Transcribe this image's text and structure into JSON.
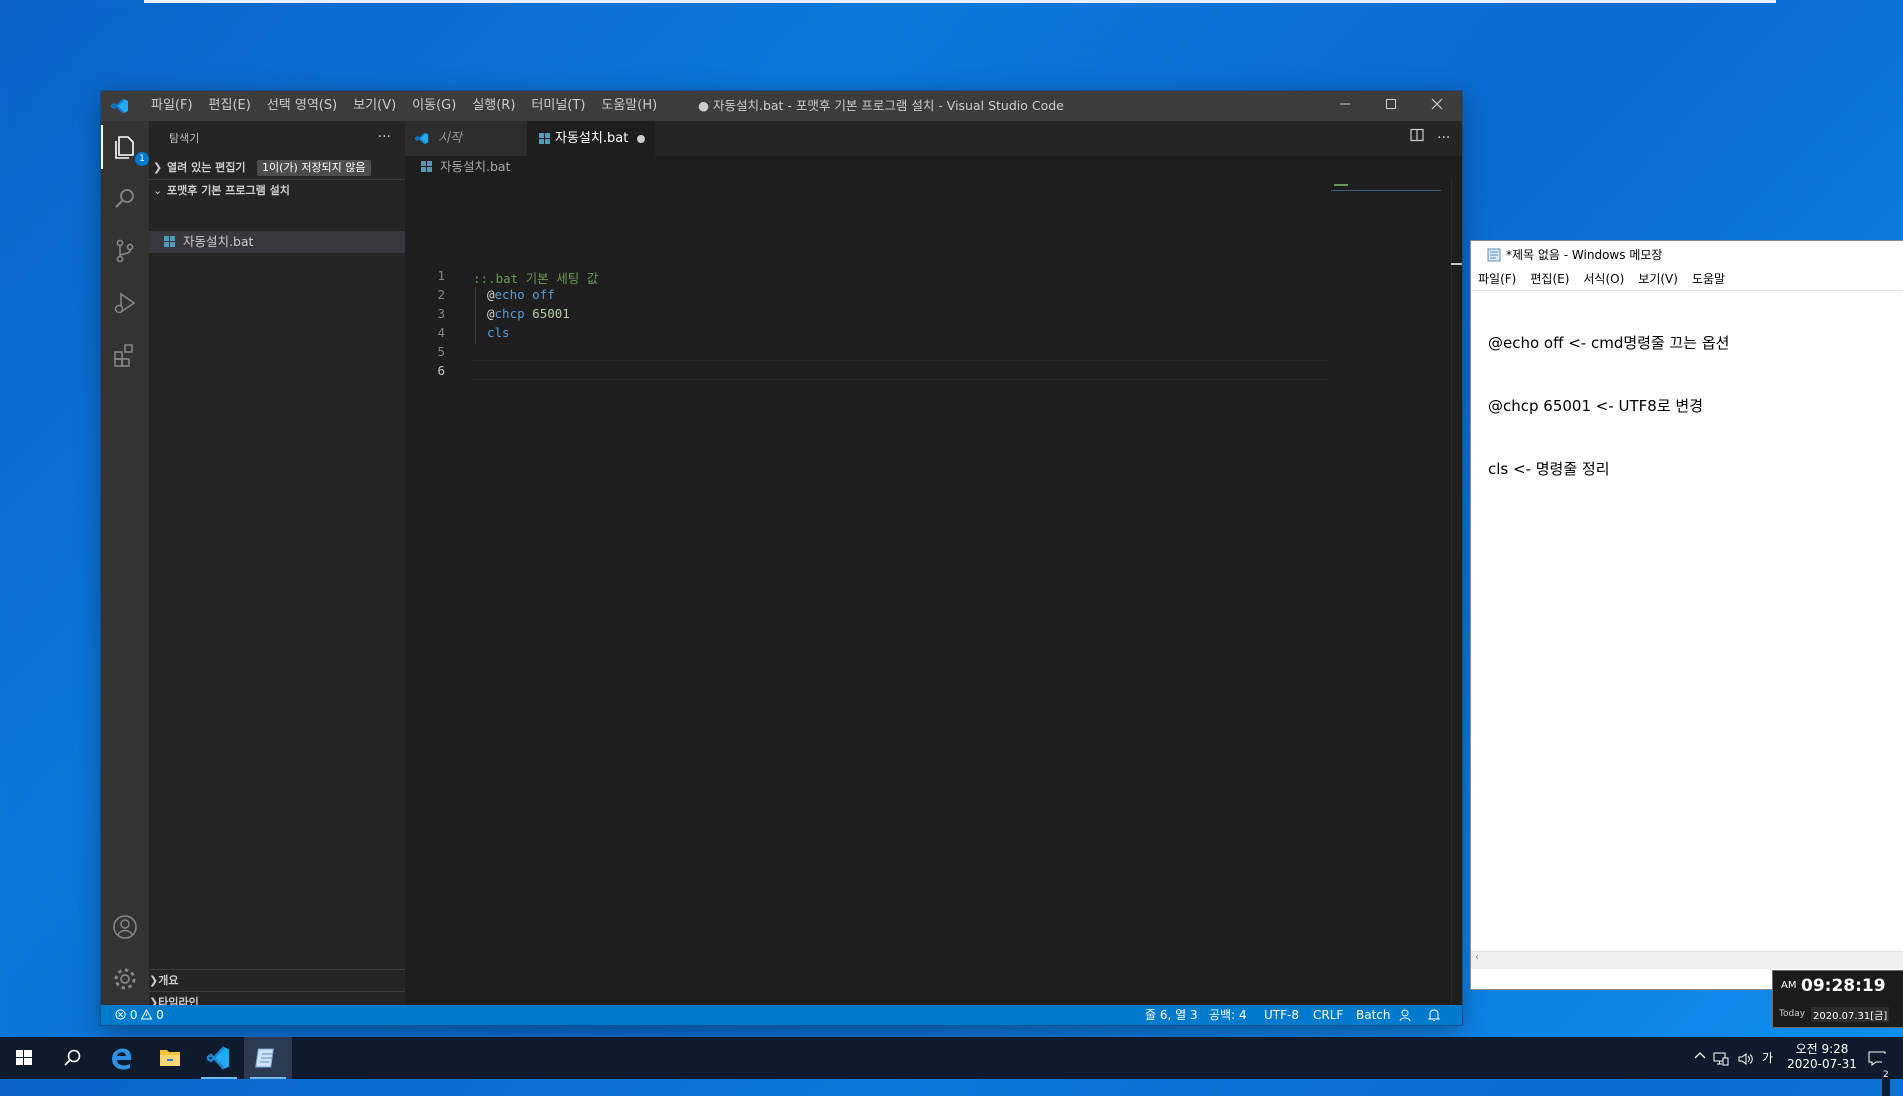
{
  "vscode": {
    "menu": [
      "파일(F)",
      "편집(E)",
      "선택 영역(S)",
      "보기(V)",
      "이동(G)",
      "실행(R)",
      "터미널(T)",
      "도움말(H)"
    ],
    "window_title": "● 자동설치.bat - 포맷후 기본 프로그램 설치 - Visual Studio Code",
    "activity_badge": "1",
    "sidebar": {
      "title": "탐색기",
      "more": "···",
      "open_editors": "열려 있는 편집기",
      "unsaved_badge": "1이(가) 저장되지 않음",
      "folder": "포맷후 기본 프로그램 설치",
      "file": "자동설치.bat",
      "outline": "개요",
      "timeline": "타임라인"
    },
    "tabs": [
      {
        "label": "시작"
      },
      {
        "label": "자동설치.bat"
      }
    ],
    "breadcrumb": "자동설치.bat",
    "line_numbers": [
      "1",
      "2",
      "3",
      "4",
      "5",
      "6"
    ],
    "code": {
      "l1": "::.bat 기본 세팅 값",
      "l2_at": "@",
      "l2_cmd": "echo",
      "l2_arg": " off",
      "l3_at": "@",
      "l3_cmd": "chcp",
      "l3_num": " 65001",
      "l4": "cls"
    },
    "status": {
      "errors": "0",
      "warnings": "0",
      "position": "줄 6, 열 3",
      "spaces": "공백: 4",
      "encoding": "UTF-8",
      "eol": "CRLF",
      "language": "Batch"
    }
  },
  "notepad": {
    "title": "*제목 없음 - Windows 메모장",
    "menu": [
      "파일(F)",
      "편집(E)",
      "서식(O)",
      "보기(V)",
      "도움말"
    ],
    "lines": [
      "@echo off <- cmd명령줄 끄는 옵션",
      "@chcp 65001 <- UTF8로 변경",
      "cls <- 명령줄 정리"
    ]
  },
  "clock_widget": {
    "ampm": "AM",
    "time": "09:28:19",
    "today_label": "Today",
    "date": "2020.07.31[금]"
  },
  "taskbar": {
    "ime": "가",
    "time": "오전 9:28",
    "date": "2020-07-31",
    "notif_count": "2"
  },
  "colors": {
    "vscode_accent": "#007acc",
    "comment": "#6a9955",
    "keyword": "#569cd6",
    "number": "#b5cea8",
    "desktop": "#0b78d8"
  }
}
